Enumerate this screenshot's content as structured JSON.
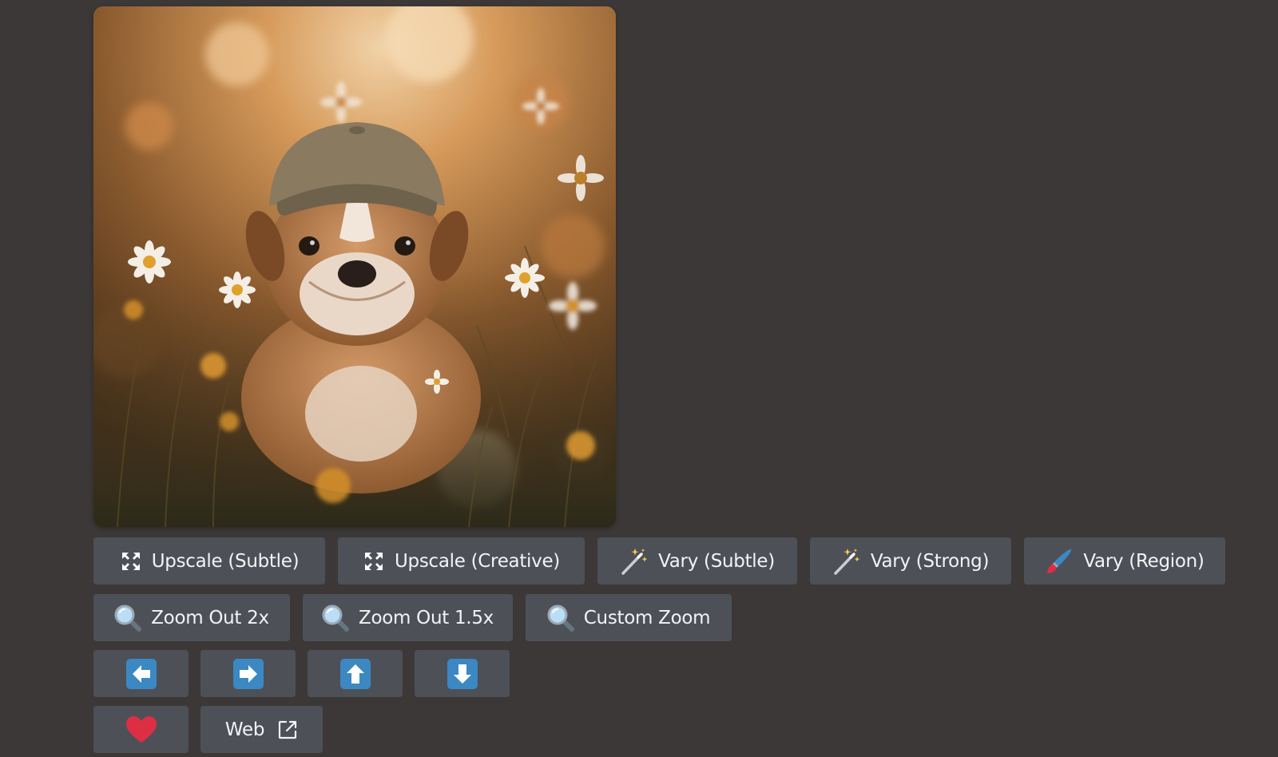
{
  "image": {
    "alt": "",
    "colors": {
      "bg_warm": "#c48848",
      "bg_dark": "#3a2614",
      "fur": "#b67845",
      "cap": "#8a7a60"
    }
  },
  "buttons": {
    "row1": [
      {
        "id": "upscale-subtle",
        "label": "Upscale (Subtle)",
        "icon": "expand-icon"
      },
      {
        "id": "upscale-creative",
        "label": "Upscale (Creative)",
        "icon": "expand-icon"
      },
      {
        "id": "vary-subtle",
        "label": "Vary (Subtle)",
        "icon": "magic-wand-icon"
      },
      {
        "id": "vary-strong",
        "label": "Vary (Strong)",
        "icon": "magic-wand-icon"
      },
      {
        "id": "vary-region",
        "label": "Vary (Region)",
        "icon": "paintbrush-icon"
      }
    ],
    "row2": [
      {
        "id": "zoom-out-2x",
        "label": "Zoom Out 2x",
        "icon": "magnifier-icon"
      },
      {
        "id": "zoom-out-1-5x",
        "label": "Zoom Out 1.5x",
        "icon": "magnifier-icon"
      },
      {
        "id": "custom-zoom",
        "label": "Custom Zoom",
        "icon": "magnifier-icon"
      }
    ],
    "row3": [
      {
        "id": "pan-left",
        "icon": "arrow-left-icon"
      },
      {
        "id": "pan-right",
        "icon": "arrow-right-icon"
      },
      {
        "id": "pan-up",
        "icon": "arrow-up-icon"
      },
      {
        "id": "pan-down",
        "icon": "arrow-down-icon"
      }
    ],
    "row4": {
      "favorite_icon": "heart-icon",
      "web_label": "Web",
      "web_icon": "external-link-icon"
    }
  },
  "colors": {
    "page_bg": "#3b3837",
    "button_bg": "#4e5058",
    "button_text": "#f2f3f5",
    "arrow_blue": "#3b88c3",
    "heart_red": "#dd2e44"
  }
}
